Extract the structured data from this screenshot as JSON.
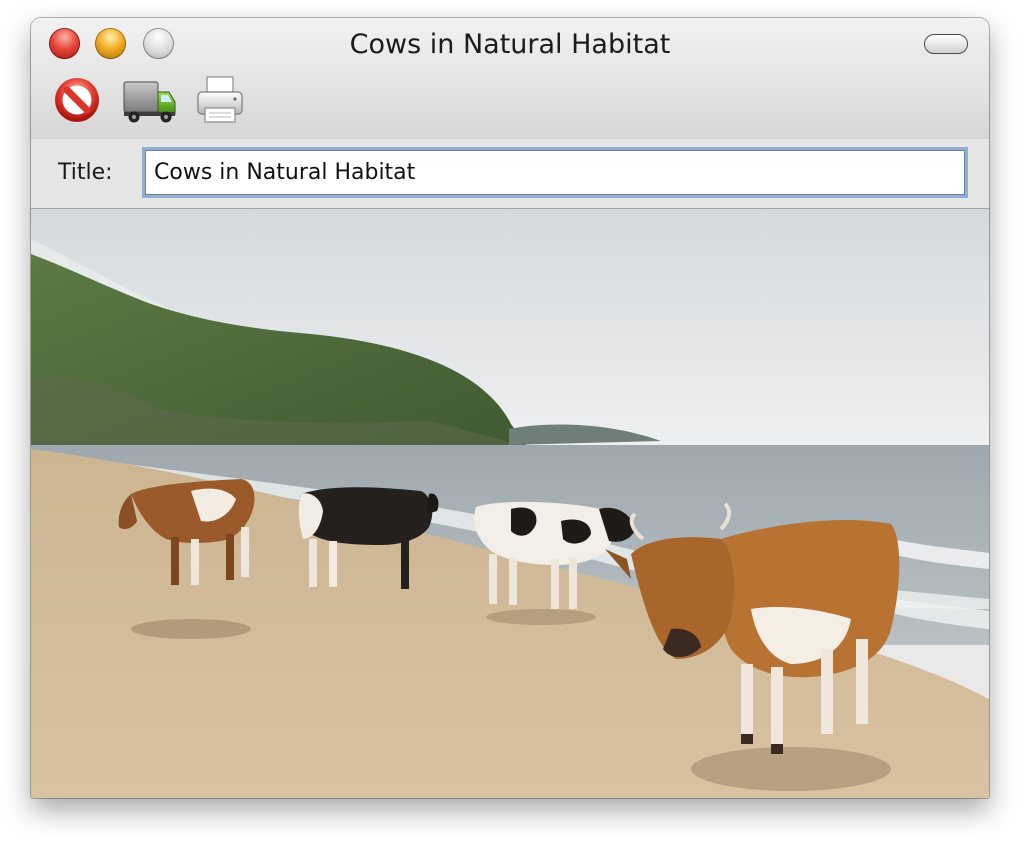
{
  "window": {
    "title": "Cows in Natural Habitat"
  },
  "toolbar": {
    "buttons": [
      {
        "icon": "no-entry-icon"
      },
      {
        "icon": "truck-icon"
      },
      {
        "icon": "printer-icon"
      }
    ]
  },
  "form": {
    "title_label": "Title:",
    "title_value": "Cows in Natural Habitat"
  },
  "image": {
    "subject": "cows-on-beach-photo"
  }
}
